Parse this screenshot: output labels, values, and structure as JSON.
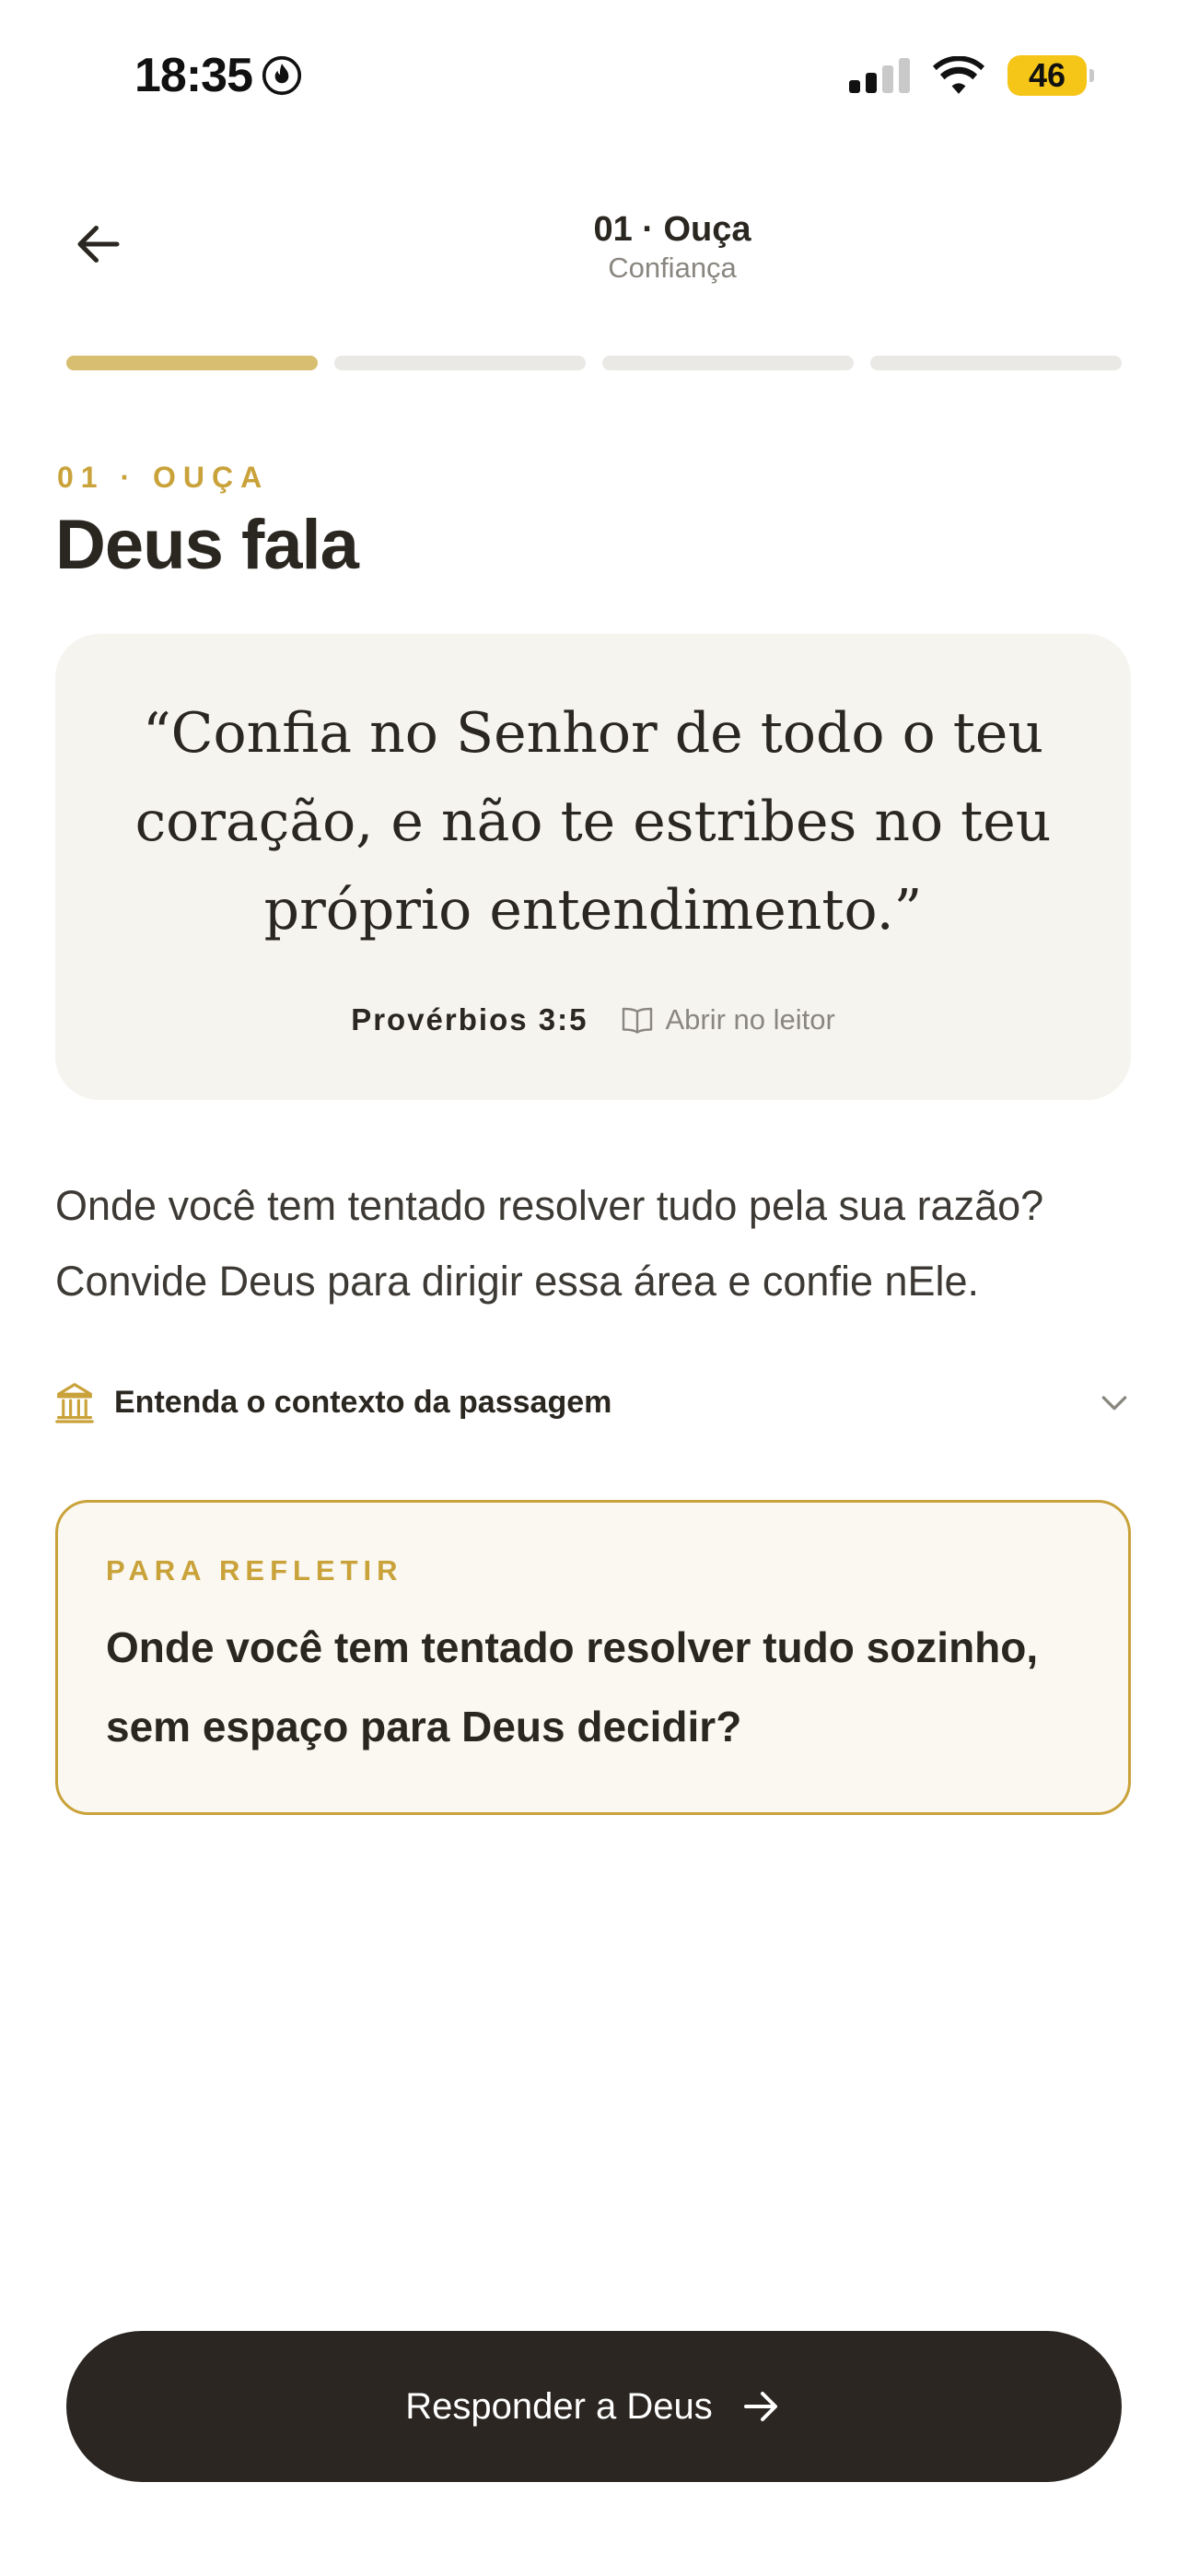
{
  "status_bar": {
    "time": "18:35",
    "battery": "46",
    "battery_color": "#f5c518"
  },
  "header": {
    "step_title": "01 · Ouça",
    "subtitle": "Confiança",
    "progress": {
      "total_steps": 4,
      "current_step": 1
    }
  },
  "section": {
    "eyebrow": "01 · OUÇA",
    "title": "Deus fala"
  },
  "verse": {
    "text": "“Confia no Senhor de todo o teu coração, e não te estribes no teu próprio entendimento.”",
    "reference": "Provérbios 3:5",
    "open_reader_label": "Abrir no leitor"
  },
  "body": {
    "text": "Onde você tem tentado resolver tudo pela sua razão? Convide Deus para dirigir essa área e confie nEle."
  },
  "context": {
    "label": "Entenda o contexto da passagem"
  },
  "reflection": {
    "eyebrow": "PARA REFLETIR",
    "text": "Onde você tem tentado resolver tudo sozinho, sem espaço para Deus decidir?"
  },
  "cta": {
    "label": "Responder a Deus"
  },
  "colors": {
    "accent": "#c9a23a",
    "progress_active": "#d8be70",
    "card_bg": "#f6f4ef",
    "cta_bg": "#2b2621"
  }
}
